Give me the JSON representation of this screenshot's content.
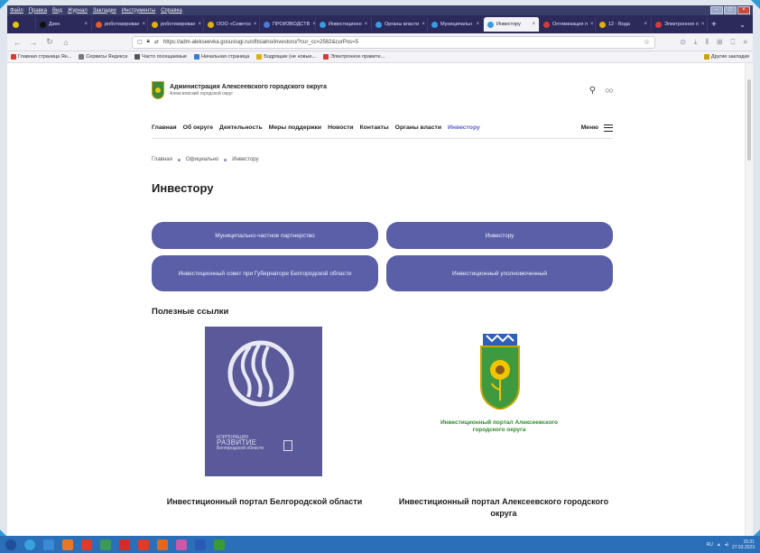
{
  "browser": {
    "menu_items": [
      "Файл",
      "Правка",
      "Вид",
      "Журнал",
      "Закладки",
      "Инструменты",
      "Справка"
    ],
    "tabs": [
      {
        "label": "",
        "color": "#e3c400",
        "small": true
      },
      {
        "label": "Дзен",
        "color": "#111111",
        "small": false
      },
      {
        "label": "роботизирован",
        "color": "#e05a2a",
        "small": false
      },
      {
        "label": "роботизирован",
        "color": "#e0b000",
        "small": false
      },
      {
        "label": "ООО «Советск",
        "color": "#e0b000",
        "small": false
      },
      {
        "label": "ПРОИЗВОДСТВ",
        "color": "#4a7ad8",
        "small": false
      },
      {
        "label": "Инвестиционн",
        "color": "#3a9ae0",
        "small": false
      },
      {
        "label": "Органы власти",
        "color": "#3a9ae0",
        "small": false
      },
      {
        "label": "Муниципальн",
        "color": "#3a9ae0",
        "small": false
      },
      {
        "label": "Инвестору",
        "color": "#3a9ae0",
        "small": false,
        "active": true
      },
      {
        "label": "Оптимизация п",
        "color": "#d83a3a",
        "small": false
      },
      {
        "label": "12 - Вода",
        "color": "#e0b000",
        "small": false
      },
      {
        "label": "Электронное п",
        "color": "#d83a3a",
        "small": false
      }
    ],
    "url": "https://adm-alekseevka.gosuslugi.ru/ofitsialno/investoru/?cur_cc=2562&curPos=5",
    "bookmarks": [
      {
        "label": "Главная страница Ян...",
        "color": "#e03a2a"
      },
      {
        "label": "Сервисы Яндекса",
        "color": "#777777"
      },
      {
        "label": "Часто посещаемые",
        "color": "#555555"
      },
      {
        "label": "Начальная страница",
        "color": "#3a7ad8"
      },
      {
        "label": "Бодрящие (не новые...",
        "color": "#e0b000"
      },
      {
        "label": "Электронное правите...",
        "color": "#d83a3a"
      }
    ],
    "bookmarks_right": "Другие закладки"
  },
  "site": {
    "title": "Администрация Алексеевского городского округа",
    "subtitle": "Алексеевский городской округ",
    "nav": [
      {
        "label": "Главная",
        "active": false
      },
      {
        "label": "Об округе",
        "active": false
      },
      {
        "label": "Деятельность",
        "active": false
      },
      {
        "label": "Меры поддержки",
        "active": false
      },
      {
        "label": "Новости",
        "active": false
      },
      {
        "label": "Контакты",
        "active": false
      },
      {
        "label": "Органы власти",
        "active": false
      },
      {
        "label": "Инвестору",
        "active": true
      }
    ],
    "menu_label": "Меню",
    "accent": "#5b5fc7"
  },
  "breadcrumb": [
    "Главная",
    "Официально",
    "Инвестору"
  ],
  "page_title": "Инвестору",
  "pills": [
    "Муниципально-частное партнерство",
    "Инвестору",
    "Инвестиционный совет при Губернаторе Белгородской области",
    "Инвестиционный уполномоченный"
  ],
  "useful_links": {
    "title": "Полезные ссылки",
    "left_card": {
      "logo_line1": "КОРПОРАЦИЯ",
      "logo_line2": "РАЗВИТИЕ",
      "logo_line3": "Белгородской области",
      "caption": "Инвестиционный портал Белгородской области"
    },
    "right_card": {
      "emblem_text": "Инвестиционный портал Алексеевского городского округа",
      "caption": "Инвестиционный портал Алексеевского городского округа"
    }
  },
  "taskbar": {
    "icons": [
      {
        "name": "start-icon",
        "color": "#1f4f9a"
      },
      {
        "name": "chrome-like-icon",
        "color": "#3aa0e0"
      },
      {
        "name": "ie-icon",
        "color": "#3a8ad8"
      },
      {
        "name": "app-icon",
        "color": "#e07a2a"
      },
      {
        "name": "yandex-icon",
        "color": "#e03a2a"
      },
      {
        "name": "folder-icon",
        "color": "#3a9a5a"
      },
      {
        "name": "opera-icon",
        "color": "#d82a2a"
      },
      {
        "name": "yandex-browser-icon",
        "color": "#e03a2a"
      },
      {
        "name": "firefox-icon",
        "color": "#e06a1a"
      },
      {
        "name": "paint-icon",
        "color": "#c85aa8"
      },
      {
        "name": "word-icon",
        "color": "#2a5ab8"
      },
      {
        "name": "image-icon",
        "color": "#3a9a3a"
      }
    ],
    "lang": "RU",
    "time": "15:31",
    "date": "27.03.2023"
  }
}
